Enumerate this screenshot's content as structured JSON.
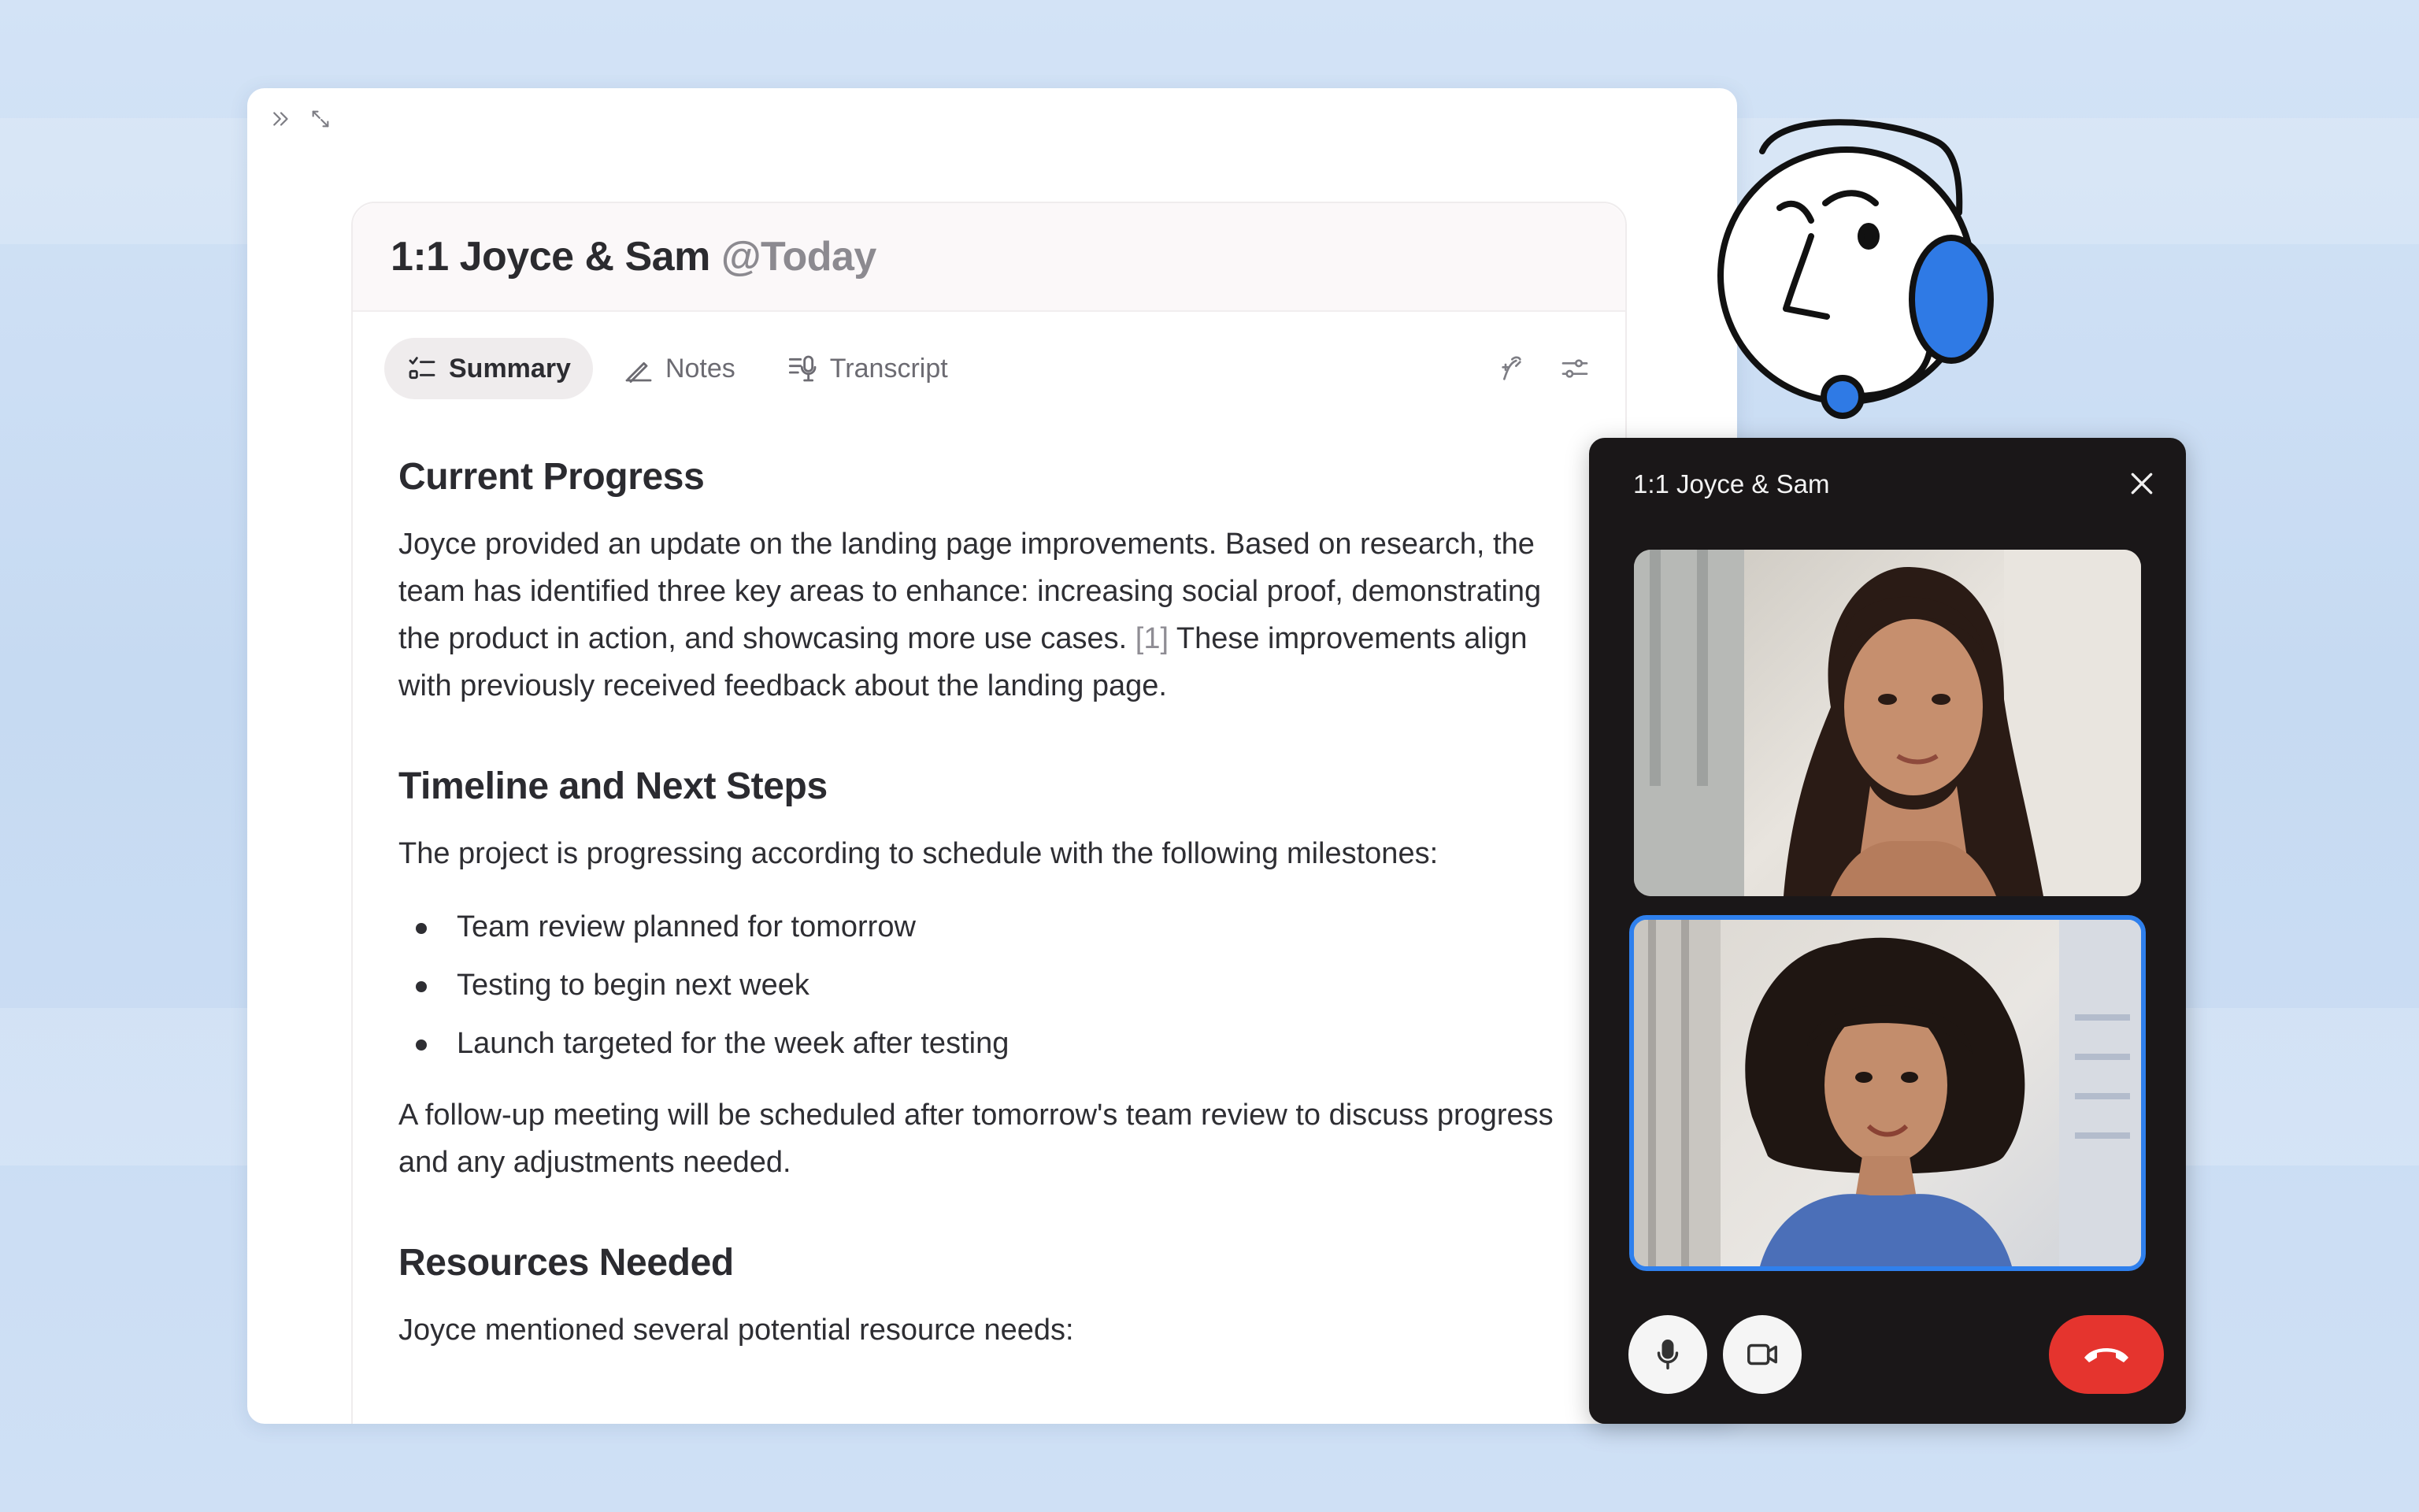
{
  "notes_panel": {
    "controls": [
      {
        "icon": "chevrons-right-icon"
      },
      {
        "icon": "collapse-arrows-icon"
      }
    ],
    "meeting": {
      "title": "1:1 Joyce & Sam",
      "date_tag": "@Today"
    },
    "tabs": [
      {
        "label": "Summary",
        "icon": "checklist-icon",
        "active": true
      },
      {
        "label": "Notes",
        "icon": "pen-icon",
        "active": false
      },
      {
        "label": "Transcript",
        "icon": "transcript-mic-icon",
        "active": false
      }
    ],
    "tools": [
      {
        "icon": "regenerate-icon"
      },
      {
        "icon": "sliders-icon"
      }
    ],
    "summary": {
      "section1": {
        "heading": "Current Progress",
        "text_before_cite": "Joyce provided an update on the landing page improvements. Based on research, the team has identified three key areas to enhance: increasing social proof, demonstrating the product in action, and showcasing more use cases.",
        "citation": "[1]",
        "text_after_cite": "These improvements align with previously received feedback about the landing page."
      },
      "section2": {
        "heading": "Timeline and Next Steps",
        "intro": "The project is progressing according to schedule with the following milestones:",
        "bullets": [
          "Team review planned for tomorrow",
          "Testing to begin next week",
          "Launch targeted for the week after testing"
        ],
        "followup": "A follow-up meeting will be scheduled after tomorrow's team review to discuss progress and any adjustments needed."
      },
      "section3": {
        "heading": "Resources Needed",
        "intro": "Joyce mentioned several potential resource needs:"
      }
    }
  },
  "call_panel": {
    "title": "1:1 Joyce & Sam",
    "participants": [
      {
        "video": "participant-1-video",
        "active_speaker": false
      },
      {
        "video": "participant-2-video",
        "active_speaker": true
      }
    ],
    "controls": {
      "mic_icon": "microphone-icon",
      "camera_icon": "video-camera-icon",
      "end_icon": "phone-hangup-icon"
    },
    "colors": {
      "end_call": "#e5342e",
      "active_border": "#2f80ed",
      "background": "#1a1718"
    }
  },
  "mascot": {
    "icon": "headset-face-mascot",
    "accent": "#2f7ae5"
  }
}
